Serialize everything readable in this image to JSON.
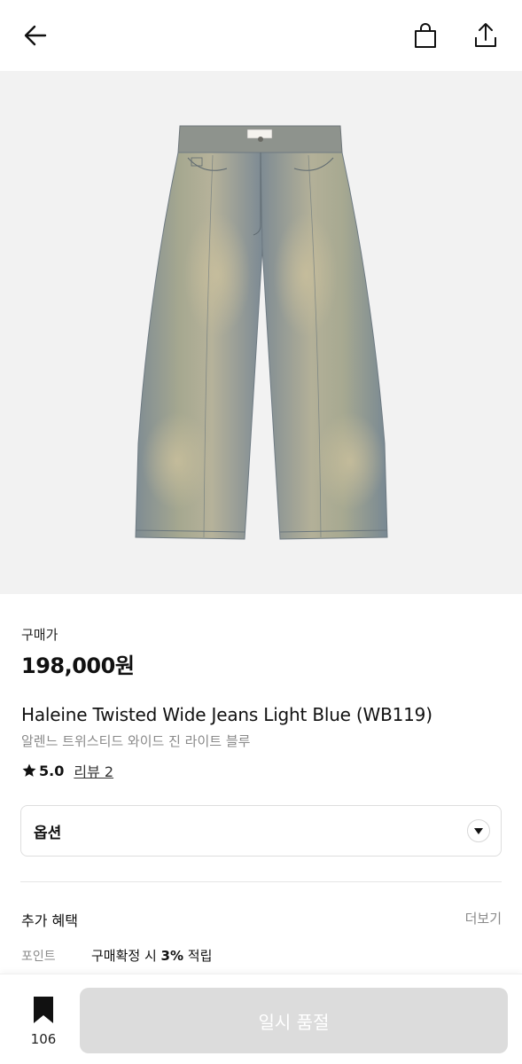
{
  "header": {
    "back_icon": "arrow-left-icon",
    "bag_icon": "shopping-bag-icon",
    "share_icon": "share-upload-icon"
  },
  "product": {
    "image_icon": "jeans-product-image",
    "price_label": "구매가",
    "price": "198,000원",
    "name_en": "Haleine Twisted Wide Jeans Light Blue (WB119)",
    "name_ko": "알렌느 트위스티드 와이드 진 라이트 블루",
    "rating": "5.0",
    "review_link": "리뷰 2"
  },
  "option": {
    "label": "옵션"
  },
  "benefits": {
    "title": "추가 혜택",
    "more": "더보기",
    "point_label": "포인트",
    "point_prefix": "구매확정 시 ",
    "point_rate": "3%",
    "point_suffix": " 적립"
  },
  "bottom": {
    "bookmark_count": "106",
    "soldout_label": "일시 품절"
  },
  "colors": {
    "accent": "#111111",
    "soldout_bg": "#dcdcdc",
    "hero_bg": "#f2f2f2",
    "muted_text": "#8a8a8a"
  }
}
